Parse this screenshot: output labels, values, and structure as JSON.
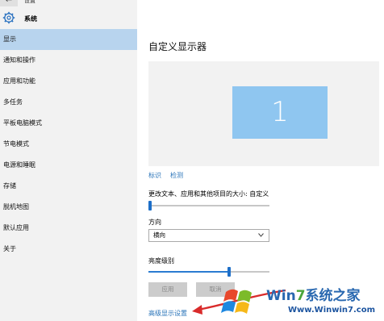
{
  "window": {
    "title": "设置"
  },
  "header": {
    "label": "系统"
  },
  "sidebar": {
    "items": [
      {
        "label": "显示",
        "active": true
      },
      {
        "label": "通知和操作"
      },
      {
        "label": "应用和功能"
      },
      {
        "label": "多任务"
      },
      {
        "label": "平板电脑模式"
      },
      {
        "label": "节电模式"
      },
      {
        "label": "电源和睡眠"
      },
      {
        "label": "存储"
      },
      {
        "label": "脱机地图"
      },
      {
        "label": "默认应用"
      },
      {
        "label": "关于"
      }
    ]
  },
  "main": {
    "title": "自定义显示器",
    "monitor_number": "1",
    "identify_link": "标识",
    "detect_link": "检测",
    "scale_label": "更改文本、应用和其他项目的大小: 自定义",
    "scale_level": 0.0,
    "orientation_label": "方向",
    "orientation_value": "横向",
    "brightness_label": "亮度级别",
    "brightness_level": 0.67,
    "apply_label": "应用",
    "cancel_label": "取消",
    "advanced_link": "高级显示设置"
  },
  "watermark": {
    "title_prefix": "Win",
    "title_digit": "7",
    "title_suffix": "系统之家",
    "url": "Www.Winwin7.com"
  },
  "colors": {
    "accent": "#2a7bd1",
    "active_nav": "#b8d4ee",
    "monitor": "#8fc6f0",
    "link": "#2a74b9",
    "arrow": "#d92b2b"
  }
}
